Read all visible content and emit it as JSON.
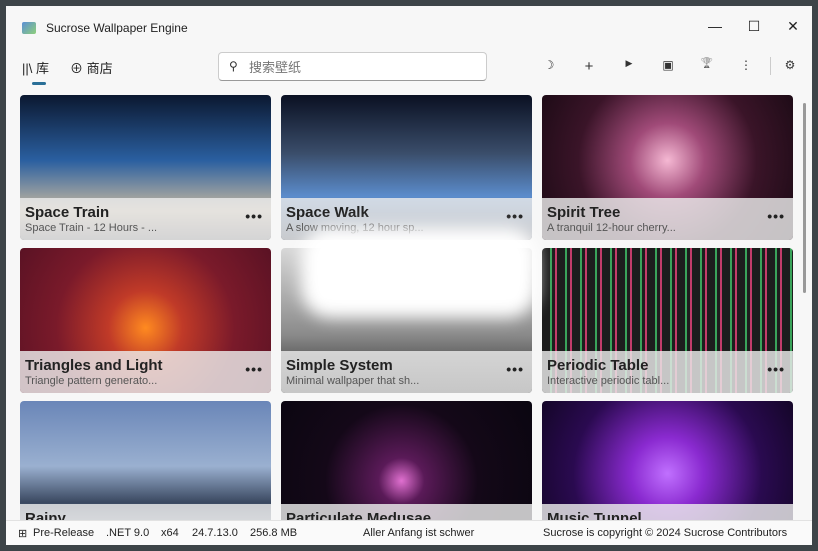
{
  "window": {
    "title": "Sucrose Wallpaper Engine",
    "minimize": "—",
    "maximize": "☐",
    "close": "✕"
  },
  "nav": {
    "library": "库",
    "store": "商店"
  },
  "search": {
    "placeholder": "搜索壁纸"
  },
  "toolbar": {
    "theme": "☽",
    "add": "+",
    "play": "▶",
    "display": "▣",
    "trophy": "🏆",
    "more": "⋮",
    "settings": "⚙"
  },
  "cards": [
    {
      "title": "Space Train",
      "subtitle": "Space Train - 12 Hours - ...",
      "bg": "linear-gradient(180deg,#0b1830 0%,#2a5fa0 45%,#c8b9a0 80%,#6c6c70 100%)"
    },
    {
      "title": "Space Walk",
      "subtitle": "A slow moving, 12 hour sp...",
      "bg": "linear-gradient(180deg,#0a1022 0%,#3a4d6a 40%,#5b8ccc 70%,#2b3548 100%)"
    },
    {
      "title": "Spirit Tree",
      "subtitle": "A tranquil 12-hour cherry...",
      "bg": "radial-gradient(circle at 50% 45%,#f5b8d3 0%,#a04a78 25%,#3a1428 60%,#1a0a14 100%)"
    },
    {
      "title": "Triangles and Light",
      "subtitle": "Triangle pattern generato...",
      "bg": "radial-gradient(circle at 50% 55%,#ff8a20 0%,#c03a28 25%,#7a1a2a 60%,#5a1224 100%)"
    },
    {
      "title": "Simple System",
      "subtitle": "Minimal wallpaper that sh...",
      "bg": "linear-gradient(180deg,#d8d8d8 0%,#8a8a8a 60%,#202020 100%)"
    },
    {
      "title": "Periodic Table",
      "subtitle": "Interactive periodic tabl...",
      "bg": "repeating-linear-gradient(90deg,#1d1d1d 0 8px,#3aa35a 8px 10px,#1d1d1d 10px 13px,#c43c6a 13px 15px)"
    },
    {
      "title": "Rainy",
      "subtitle": "",
      "bg": "linear-gradient(180deg,#6a86b8 0%,#9ab0d0 45%,#3a4860 70%,#c8d0dc 100%)"
    },
    {
      "title": "Particulate Medusae",
      "subtitle": "",
      "bg": "radial-gradient(circle at 48% 55%,#e070d0 0%,#5a1a58 15%,#140818 50%,#0a0610 100%)"
    },
    {
      "title": "Music Tunnel",
      "subtitle": "",
      "bg": "radial-gradient(circle at 50% 50%,#c070ff 0%,#8a2ad0 25%,#2a0a50 65%,#140628 100%)"
    }
  ],
  "more_label": "•••",
  "status": {
    "channel_icon": "⊞",
    "channel": "Pre-Release",
    "runtime": ".NET 9.0",
    "arch": "x64",
    "version": "24.7.13.0",
    "memory": "256.8 MB",
    "quote": "Aller Anfang ist schwer",
    "copyright": "Sucrose is copyright © 2024 Sucrose Contributors"
  }
}
